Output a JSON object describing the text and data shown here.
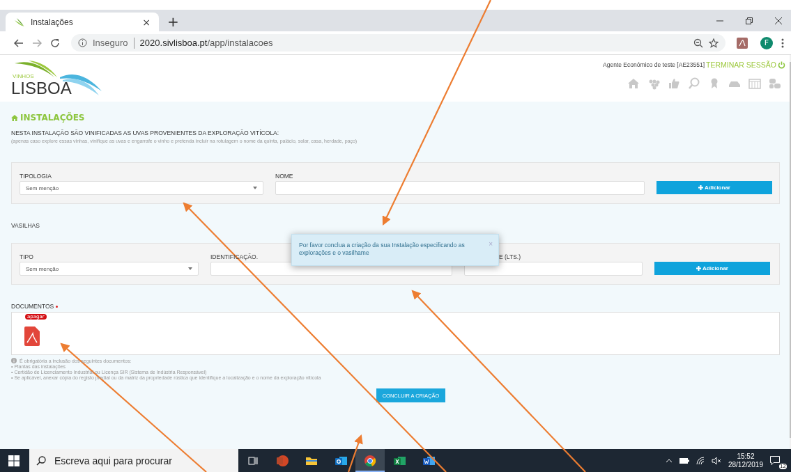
{
  "browser": {
    "tab": {
      "title": "Instalações",
      "close": "×"
    },
    "new_tab": "+",
    "security": "Inseguro",
    "url_host": "2020.sivlisboa.pt",
    "url_path": "/app/instalacoes",
    "profile": "F"
  },
  "header": {
    "logo_top": "VINHOS",
    "logo_main": "LISBOA",
    "user": "Agente Económico de teste [AE23551]",
    "logout": "TERMINAR SESSÃO"
  },
  "page": {
    "title": "INSTALAÇÕES",
    "intro": "NESTA INSTALAÇÃO SÃO VINIFICADAS AS UVAS PROVENIENTES DA EXPLORAÇÃO VITÍCOLA:",
    "note": "(apenas caso explore essas vinhas, vinifique as uvas e engarrafe o vinho e pretenda incluir na rotulagem o nome da quinta, palácio, solar, casa, herdade, paço)"
  },
  "panels": [
    {
      "fields": [
        {
          "kind": "select",
          "label": "TIPOLOGIA",
          "value": "Sem menção"
        },
        {
          "kind": "text",
          "label": "NOME"
        }
      ],
      "button": "Adicionar"
    },
    {
      "heading": "VASILHAS",
      "fields": [
        {
          "kind": "select",
          "label": "TIPO",
          "value": "Sem menção"
        },
        {
          "kind": "text",
          "label": "IDENTIFICAÇÃO."
        },
        {
          "kind": "text",
          "label": "E (LTS.)"
        }
      ],
      "button": "Adicionar"
    }
  ],
  "documents": {
    "label": "DOCUMENTOS",
    "required": true,
    "files": [
      {
        "badge": "apagar"
      }
    ],
    "info_title": "É obrigatória a inclusão dos seguintes documentos:",
    "info_items": [
      "• Plantas das instalações",
      "• Certidão de Licenciamento Industrial ou Licença SIR (Sistema de Indústria Responsável)",
      "• Se aplicável, anexar cópia do registo predial ou da matriz da propriedade rústica que identifique a localização e o nome da exploração vitícola"
    ]
  },
  "submit": "CONCLUIR A CRIAÇÃO",
  "toast": {
    "message": "Por favor conclua a criação da sua Instalação especificando as explorações e o vasilhame",
    "close": "×"
  },
  "taskbar": {
    "search_placeholder": "Escreva aqui para procurar",
    "apps": [
      {
        "kind": "taskview",
        "selected": false
      },
      {
        "kind": "powerpoint",
        "selected": false
      },
      {
        "kind": "explorer",
        "selected": false
      },
      {
        "kind": "outlook",
        "selected": false
      },
      {
        "kind": "chrome",
        "selected": true
      },
      {
        "kind": "excel",
        "selected": false
      },
      {
        "kind": "word",
        "selected": false
      }
    ],
    "time": "15:52",
    "date": "28/12/2019",
    "notifications": "12"
  }
}
